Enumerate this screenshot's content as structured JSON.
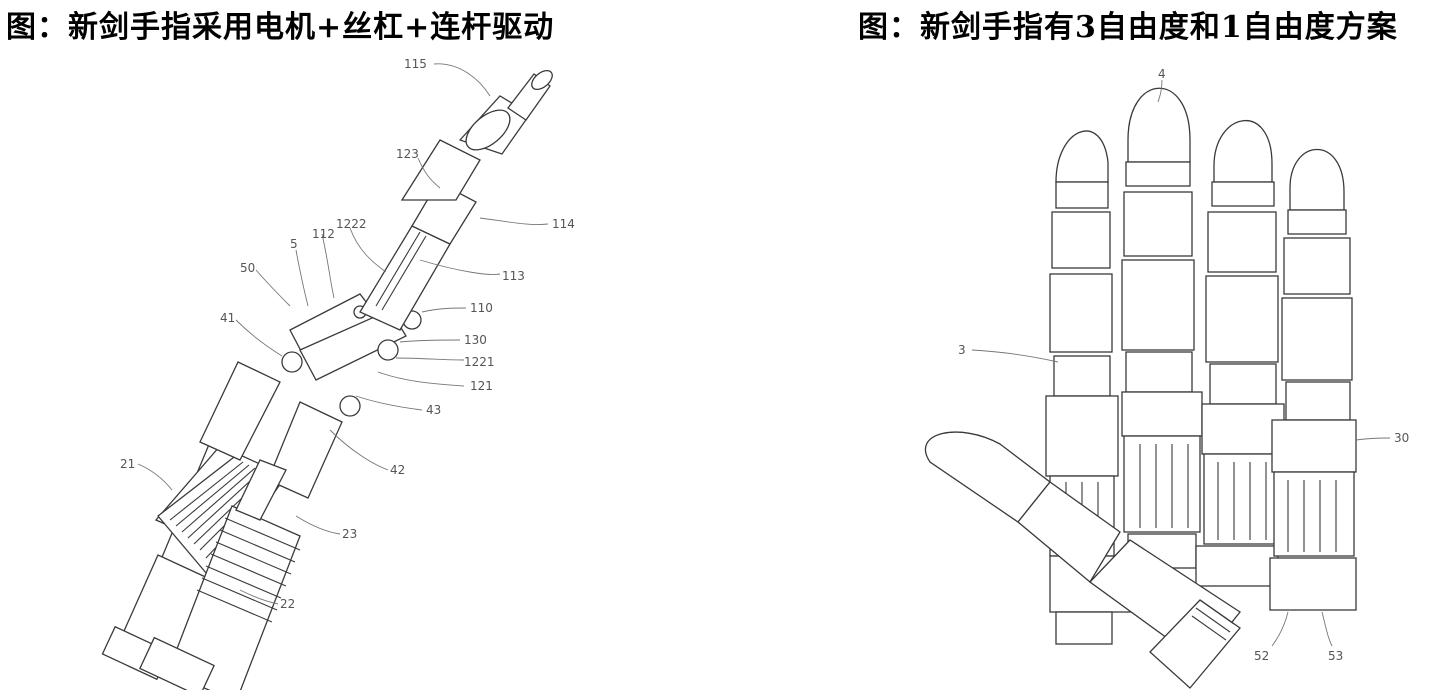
{
  "titles": {
    "left": "图：新剑手指采用电机+丝杠+连杆驱动",
    "right": "图：新剑手指有3自由度和1自由度方案"
  },
  "left_figure": {
    "labels": [
      "115",
      "123",
      "114",
      "1222",
      "112",
      "5",
      "113",
      "50",
      "110",
      "41",
      "130",
      "1221",
      "121",
      "43",
      "42",
      "21",
      "23",
      "22"
    ]
  },
  "right_figure": {
    "labels": [
      "4",
      "3",
      "30",
      "52",
      "53"
    ]
  }
}
